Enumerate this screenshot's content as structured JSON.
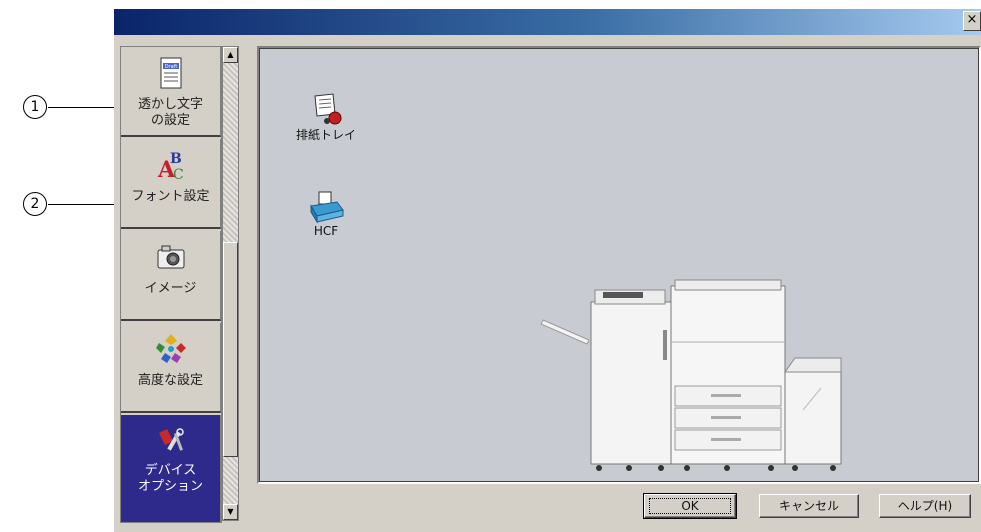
{
  "window": {
    "close_label": "×"
  },
  "sidebar": {
    "items": [
      {
        "label": "透かし文字\nの設定",
        "icon": "draft-document-icon",
        "name": "sidebar-item-watermark"
      },
      {
        "label": "フォント設定",
        "icon": "font-abc-icon",
        "name": "sidebar-item-font"
      },
      {
        "label": "イメージ",
        "icon": "camera-icon",
        "name": "sidebar-item-image"
      },
      {
        "label": "高度な設定",
        "icon": "colored-shapes-icon",
        "name": "sidebar-item-advanced"
      },
      {
        "label": "デバイス\nオプション",
        "icon": "tools-icon",
        "name": "sidebar-item-device-options",
        "selected": true
      }
    ]
  },
  "options": [
    {
      "label": "排紙トレイ",
      "icon": "output-tray-icon"
    },
    {
      "label": "HCF",
      "icon": "hcf-tray-icon"
    }
  ],
  "buttons": {
    "ok": "OK",
    "cancel": "キャンセル",
    "help": "ヘルプ(H)"
  },
  "callouts": [
    "1",
    "2"
  ],
  "colors": {
    "title_start": "#0a246a",
    "title_end": "#a6caf0",
    "selected_item": "#2d2a8c",
    "face": "#d4d0c8"
  }
}
